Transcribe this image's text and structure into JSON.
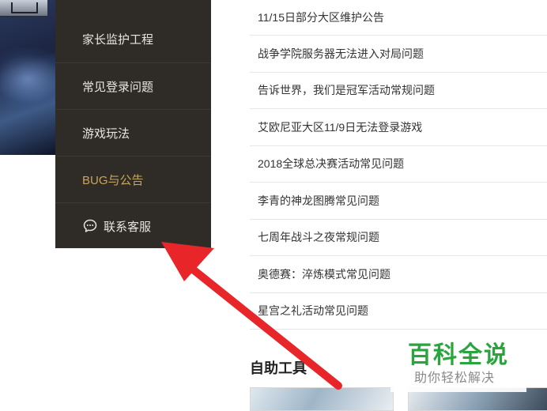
{
  "sidebar": {
    "items": [
      {
        "label": "家长监护工程"
      },
      {
        "label": "常见登录问题"
      },
      {
        "label": "游戏玩法"
      },
      {
        "label": "BUG与公告"
      },
      {
        "label": "联系客服"
      }
    ],
    "active_color": "#c9a55c",
    "background_color": "#2f2c28"
  },
  "articles": {
    "items": [
      "11/15日部分大区维护公告",
      "战争学院服务器无法进入对局问题",
      "告诉世界，我们是冠军活动常规问题",
      "艾欧尼亚大区11/9日无法登录游戏",
      "2018全球总决赛活动常见问题",
      "李青的神龙图腾常见问题",
      "七周年战斗之夜常规问题",
      "奥德赛：淬炼模式常见问题",
      "星宫之礼活动常见问题"
    ]
  },
  "tools": {
    "title": "自助工具"
  },
  "watermark": {
    "title": "百科全说",
    "subtitle": "助你轻松解决",
    "color": "#2aa53e"
  },
  "annotation": {
    "arrow_color": "#e8262a",
    "icons": [
      "chat-bubble-icon",
      "red-arrow"
    ]
  }
}
